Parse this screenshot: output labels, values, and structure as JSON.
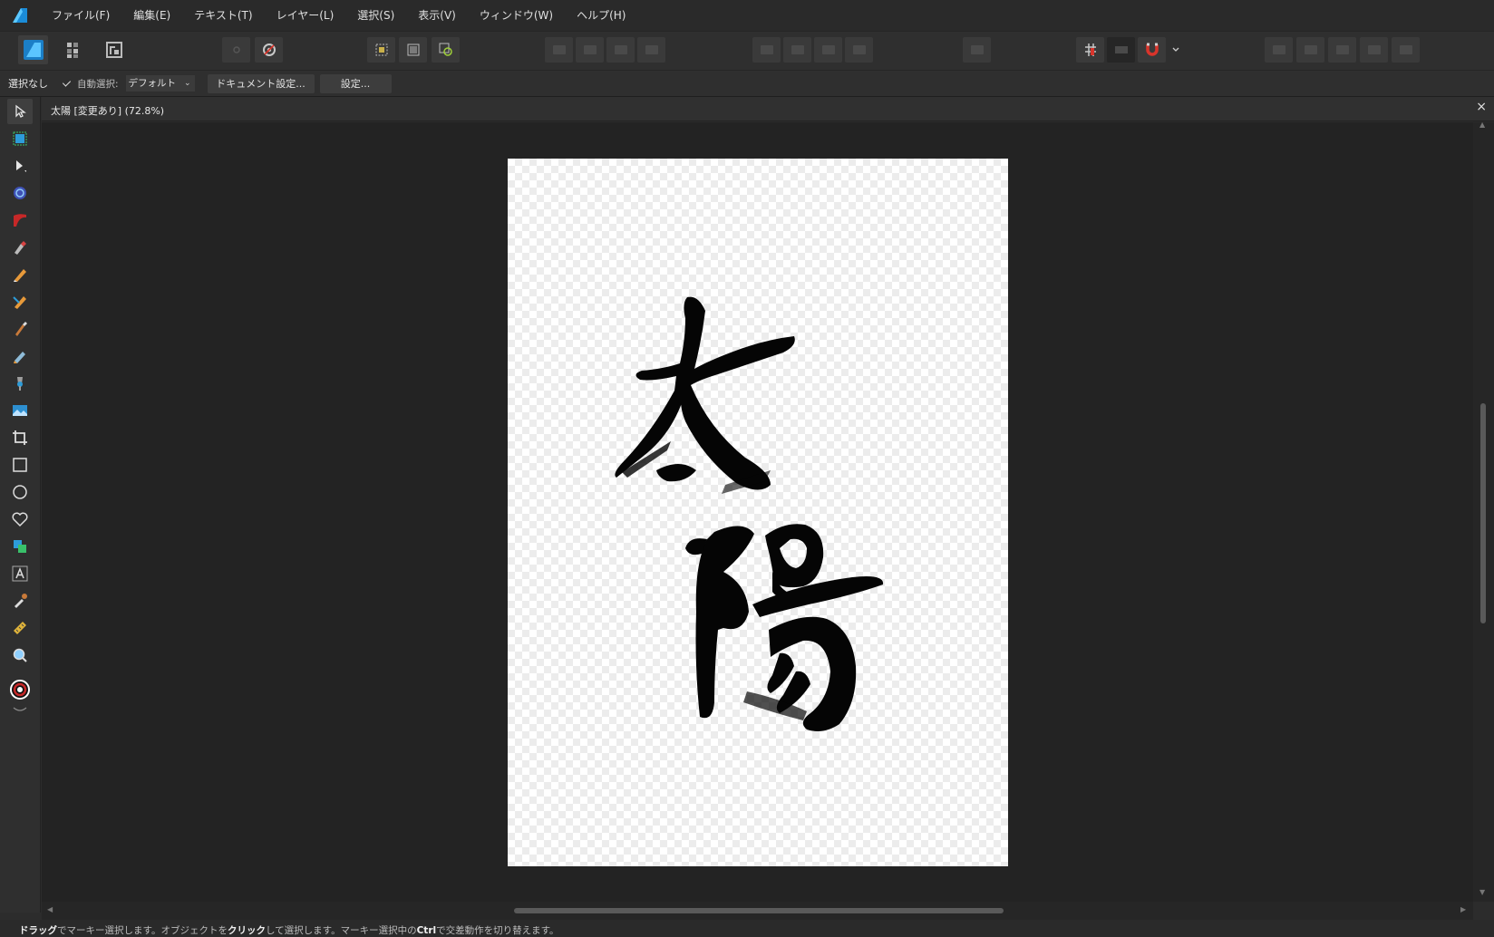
{
  "app": {
    "menu": [
      "ファイル(F)",
      "編集(E)",
      "テキスト(T)",
      "レイヤー(L)",
      "選択(S)",
      "表示(V)",
      "ウィンドウ(W)",
      "ヘルプ(H)"
    ]
  },
  "context_bar": {
    "selection_status": "選択なし",
    "auto_select_label": "自動選択:",
    "auto_select_checked": true,
    "auto_select_value": "デフォルト",
    "document_setup_button": "ドキュメント設定...",
    "settings_button": "設定..."
  },
  "document": {
    "tab_title": "太陽 [変更あり] (72.8%)",
    "close_glyph": "×",
    "artwork_text": "太陽"
  },
  "status_bar": {
    "part1_bold": "ドラッグ",
    "part2": "でマーキー選択します。オブジェクトを",
    "part3_bold": "クリック",
    "part4": "して選択します。マーキー選択中の",
    "part5_bold": "Ctrl",
    "part6": "で交差動作を切り替えます。"
  },
  "tools": [
    "move-tool-icon",
    "artboard-tool-icon",
    "node-tool-icon",
    "corner-tool-icon",
    "vector-brush-icon",
    "pen-tool-icon",
    "pencil-tool-icon",
    "vector-crop-icon",
    "paint-brush-icon",
    "pixel-brush-icon",
    "fill-tool-icon",
    "place-image-icon",
    "crop-tool-icon",
    "rectangle-tool-icon",
    "ellipse-tool-icon",
    "heart-shape-icon",
    "shape-tool-icon",
    "artistic-text-icon",
    "color-picker-icon",
    "measure-tool-icon",
    "zoom-tool-icon"
  ],
  "colors": {
    "accent": "#1e88e5",
    "background": "#232323",
    "panel": "#2f2f2f"
  }
}
